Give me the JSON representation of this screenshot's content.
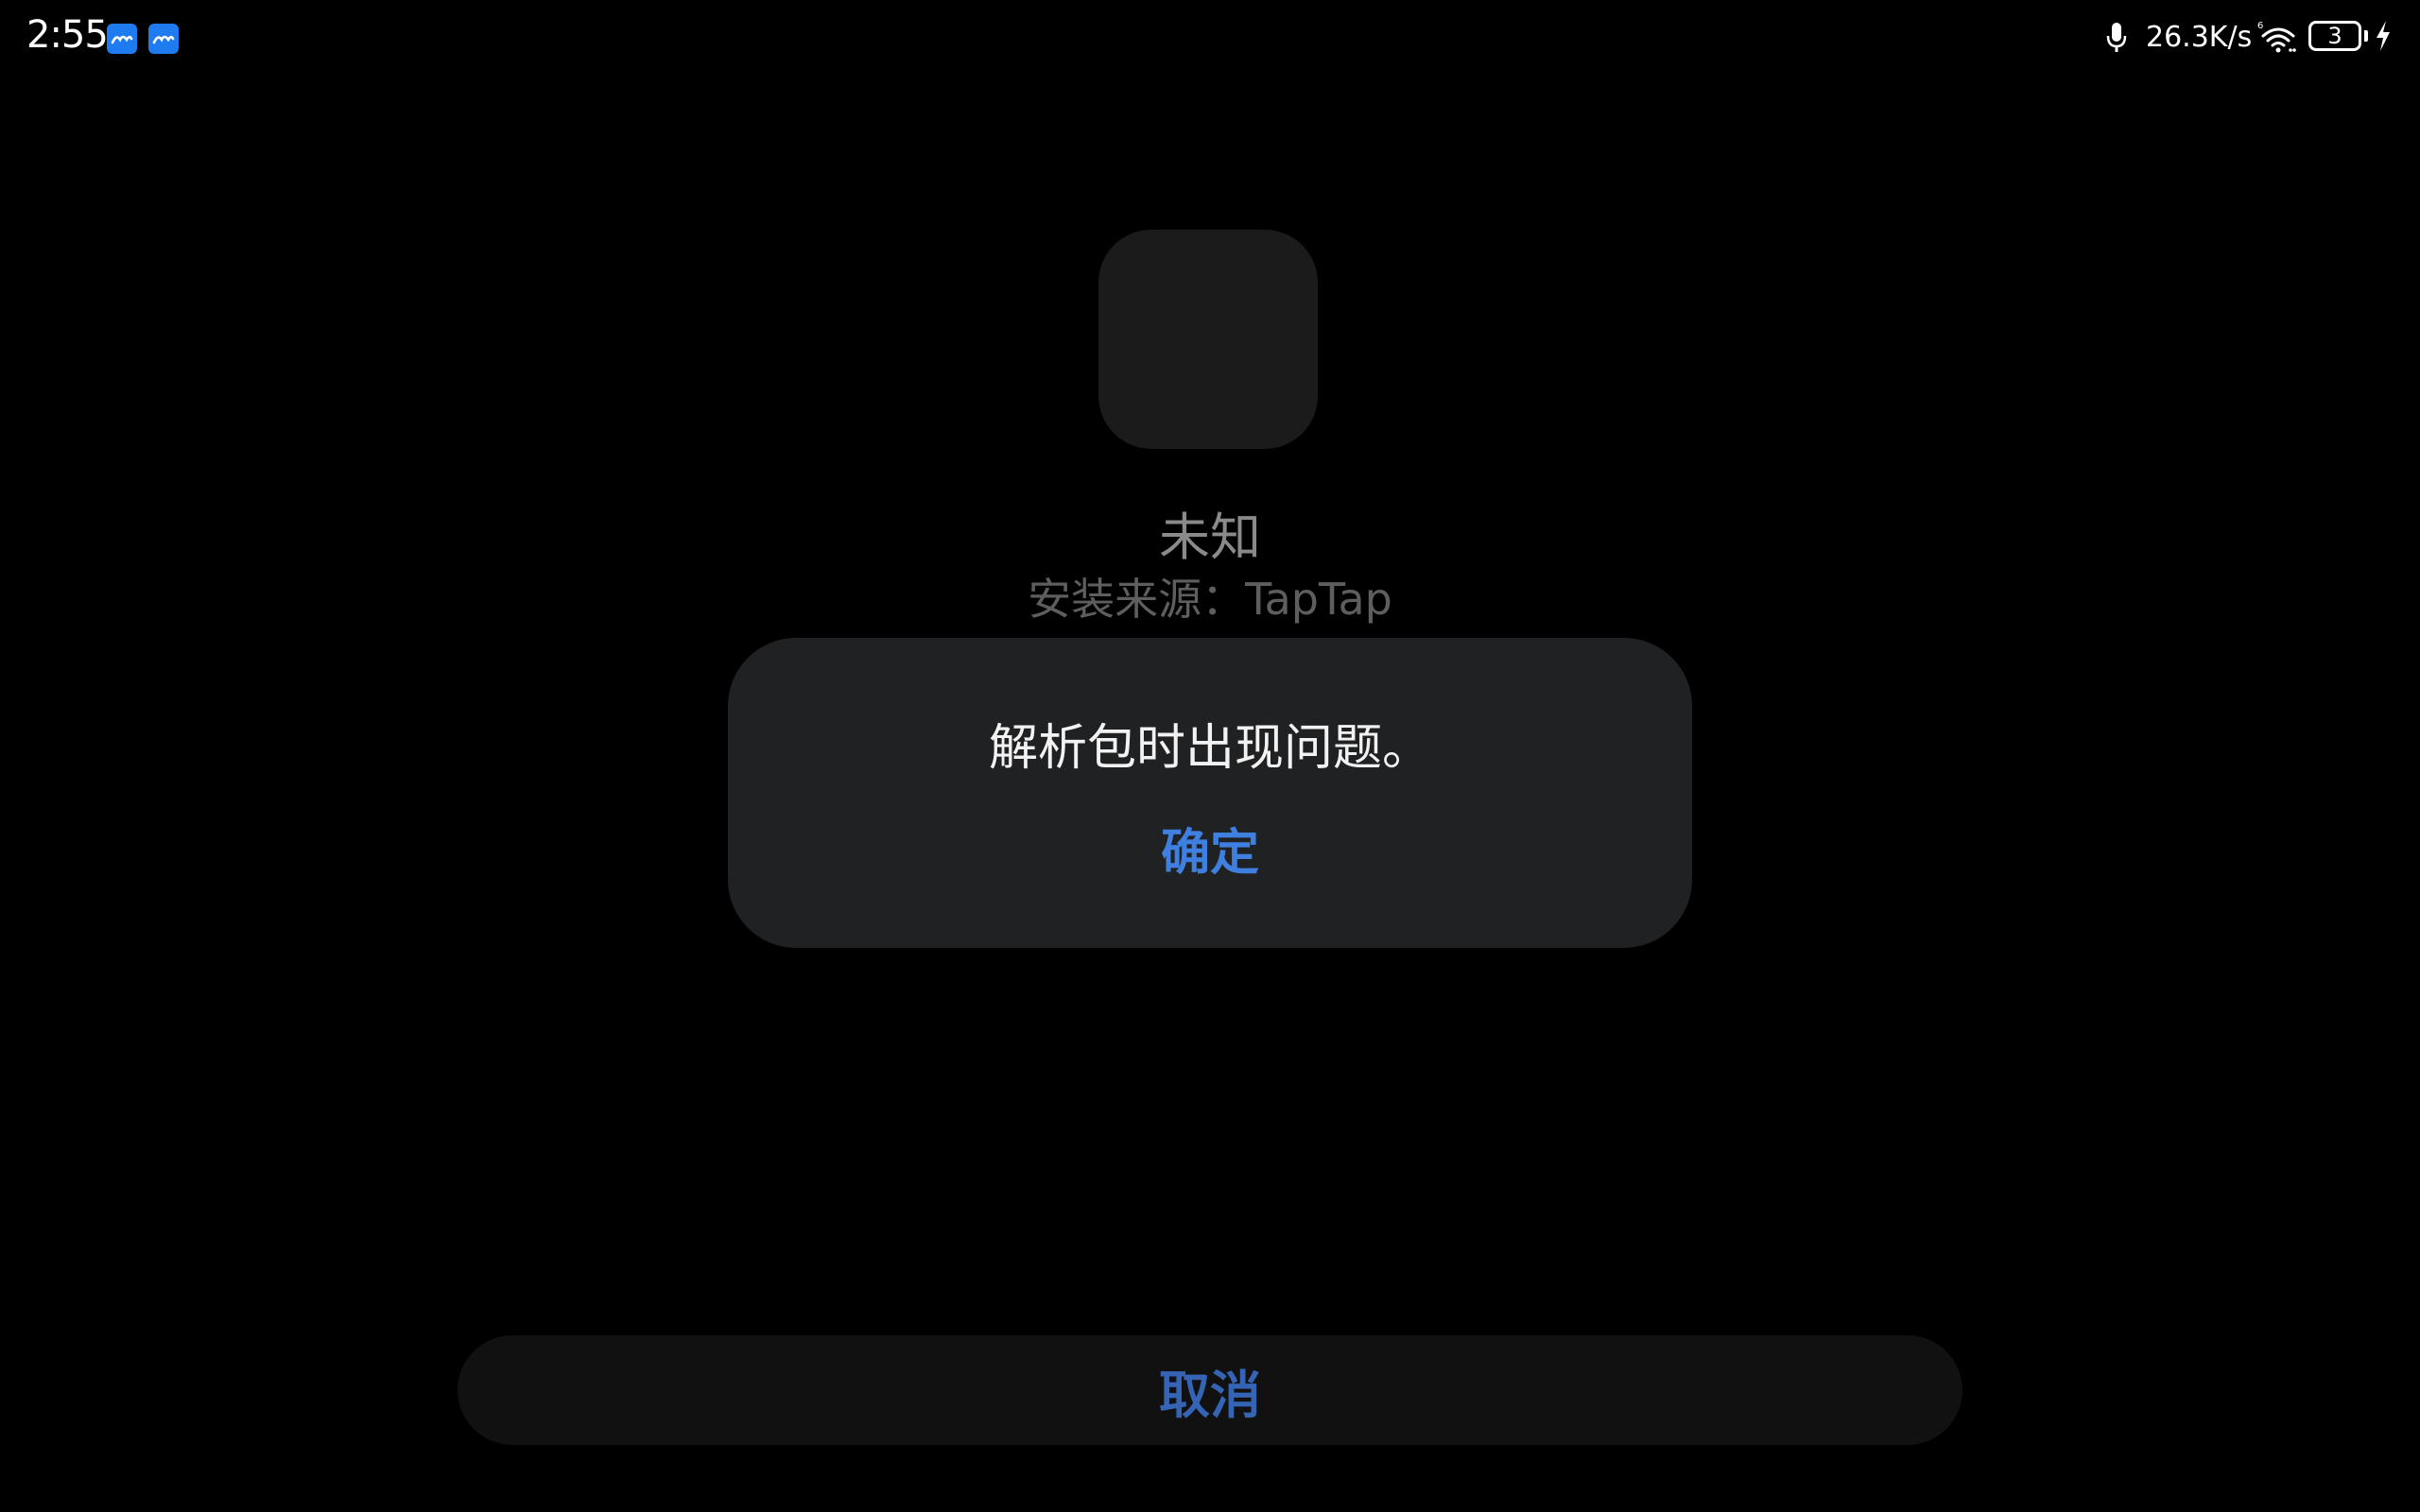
{
  "status_bar": {
    "time": "2:55",
    "notification_icons": [
      "feishu-icon",
      "feishu-icon"
    ],
    "net_speed": "26.3K/s",
    "battery_level": "3",
    "icons": [
      "mic-icon",
      "wifi-icon",
      "battery-icon",
      "charging-icon"
    ]
  },
  "app_info": {
    "name": "未知",
    "install_source": "安装来源：TapTap"
  },
  "dialog": {
    "message": "解析包时出现问题。",
    "ok_label": "确定"
  },
  "footer": {
    "cancel_label": "取消"
  },
  "colors": {
    "accent_blue": "#3e7fe0",
    "cancel_blue": "#3564b4",
    "dialog_bg": "#202123",
    "background": "#000000"
  }
}
